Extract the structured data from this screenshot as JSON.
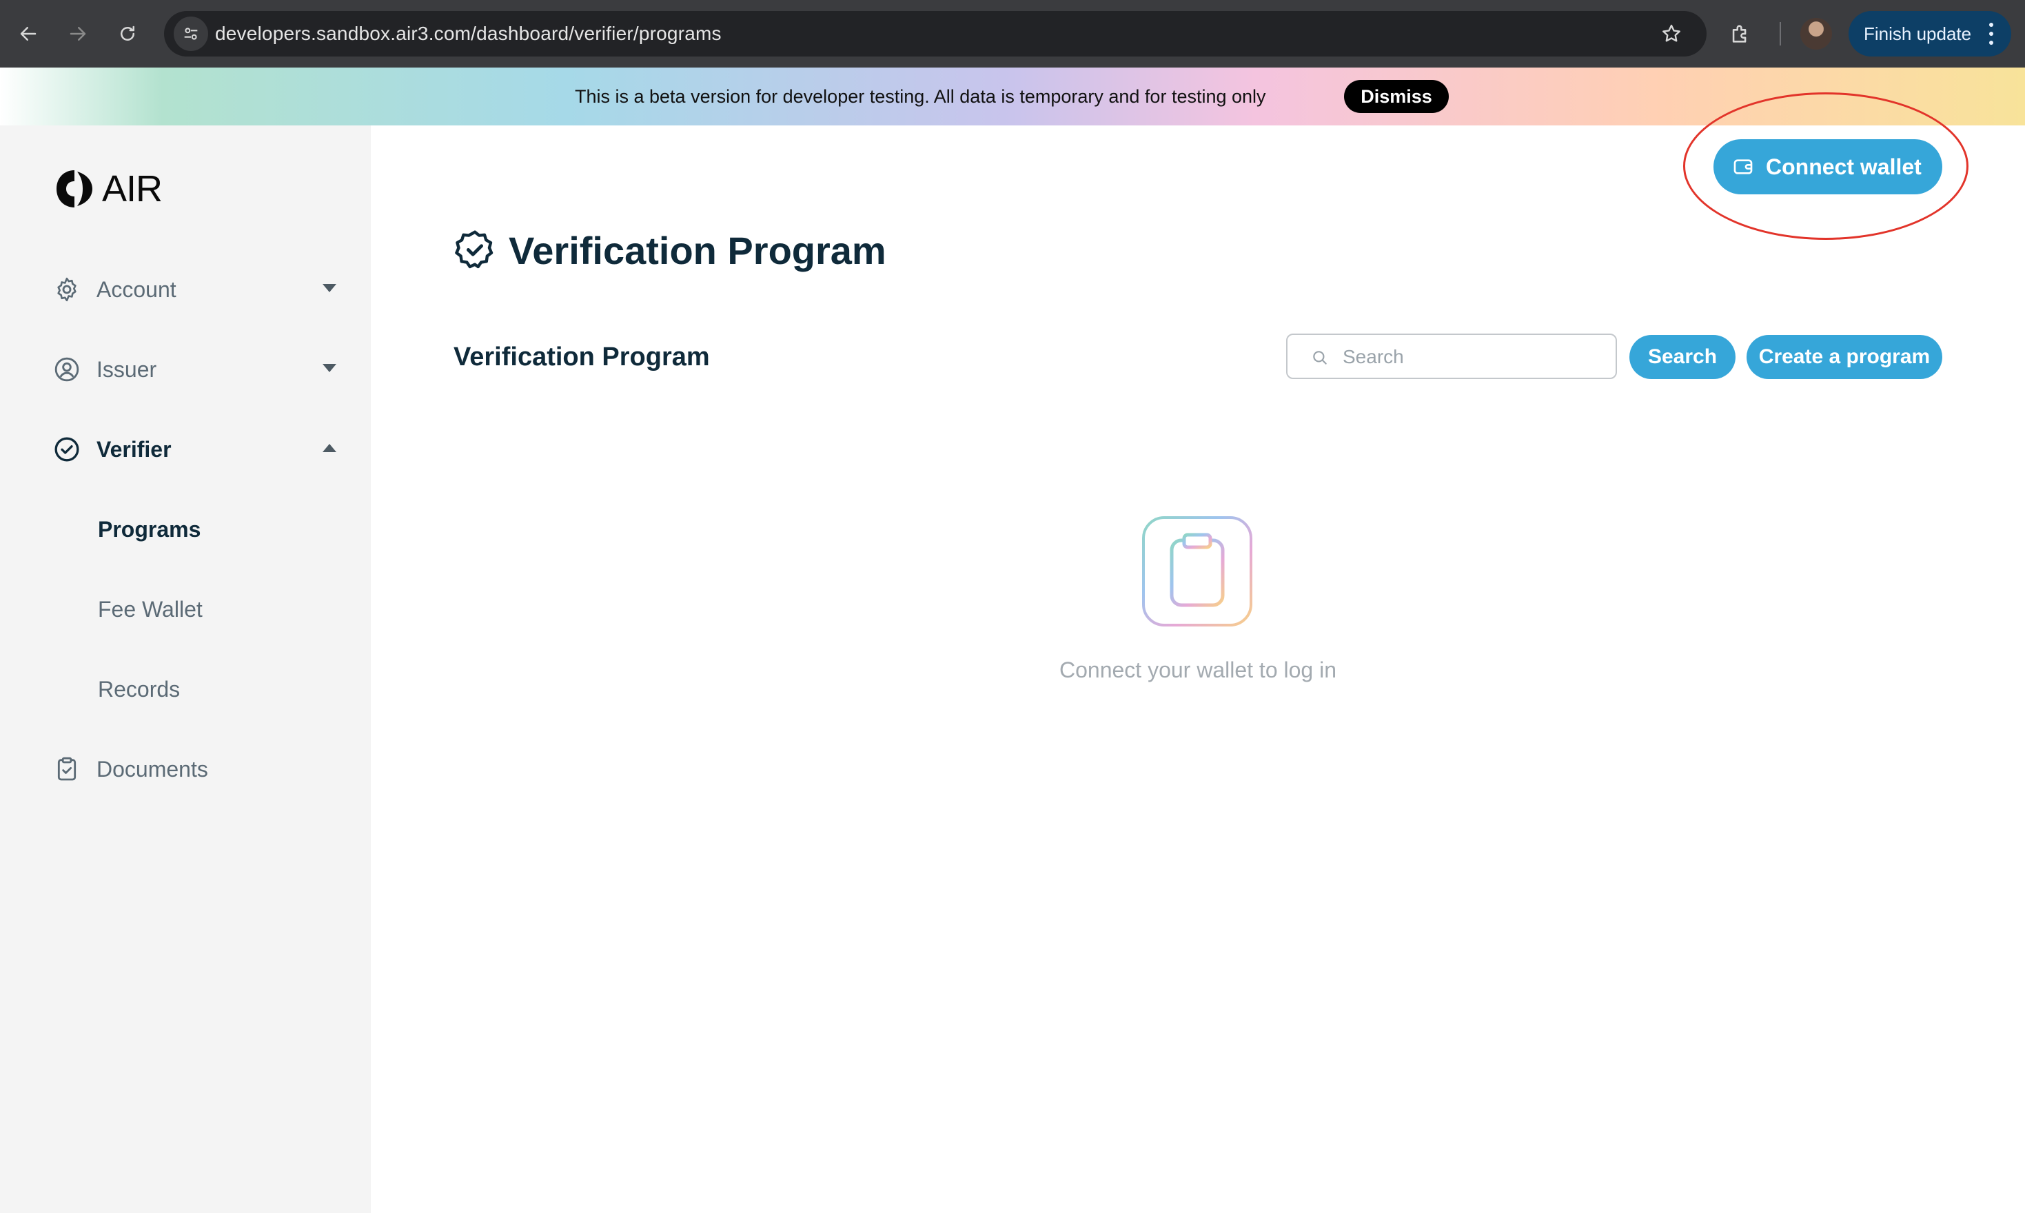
{
  "browser": {
    "url": "developers.sandbox.air3.com/dashboard/verifier/programs",
    "finish_update_label": "Finish update"
  },
  "banner": {
    "message": "This is a beta version for developer testing. All data is temporary and for testing only",
    "dismiss_label": "Dismiss"
  },
  "sidebar": {
    "logo_text": "AIR",
    "items": [
      {
        "label": "Account",
        "icon": "gear-icon",
        "expanded": false
      },
      {
        "label": "Issuer",
        "icon": "user-circle-icon",
        "expanded": false
      },
      {
        "label": "Verifier",
        "icon": "check-circle-icon",
        "expanded": true
      },
      {
        "label": "Documents",
        "icon": "clipboard-check-icon"
      }
    ],
    "verifier_subitems": [
      {
        "label": "Programs",
        "active": true
      },
      {
        "label": "Fee Wallet"
      },
      {
        "label": "Records"
      }
    ]
  },
  "header": {
    "connect_wallet_label": "Connect wallet"
  },
  "main": {
    "page_title": "Verification Program",
    "section_title": "Verification Program",
    "search_placeholder": "Search",
    "search_button_label": "Search",
    "create_button_label": "Create a program",
    "empty_state_text": "Connect your wallet to log in"
  },
  "colors": {
    "accent": "#36a6d9",
    "text_dark": "#0f2a3a",
    "annotation_red": "#e2342a"
  }
}
